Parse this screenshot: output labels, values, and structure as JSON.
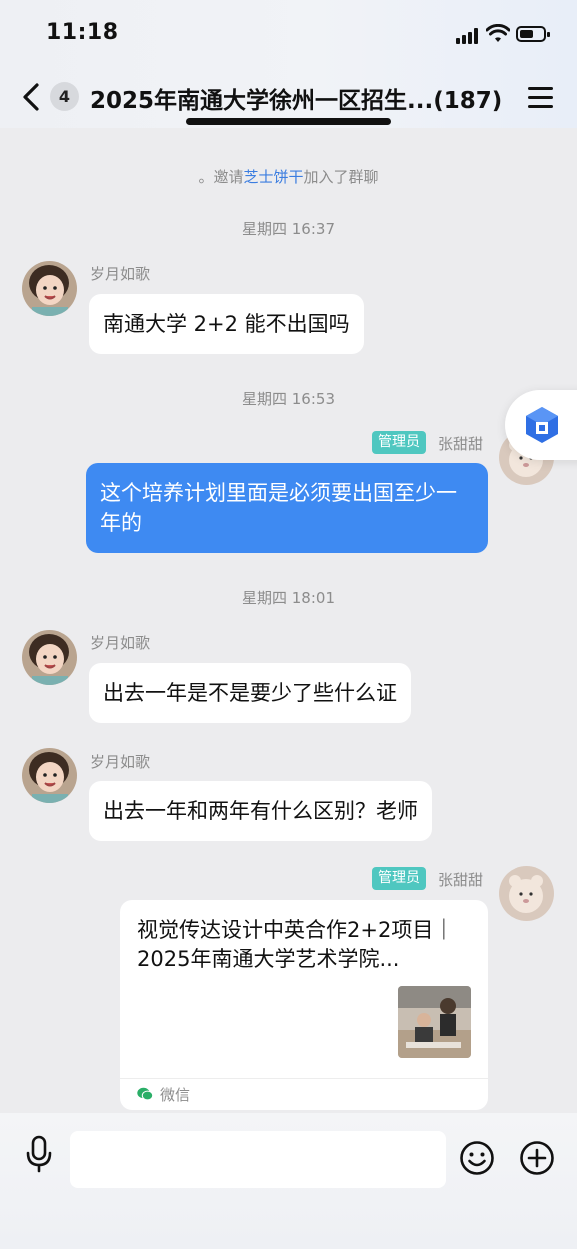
{
  "status_bar": {
    "time": "11:18"
  },
  "nav": {
    "unread_count": "4",
    "title": "2025年南通大学徐州一区招生...(187)"
  },
  "messages": {
    "system_prefix": "。邀请",
    "system_name": "芝士饼干",
    "system_suffix": "加入了群聊",
    "t1": "星期四 16:37",
    "m1_sender": "岁月如歌",
    "m1_text": "南通大学 2+2 能不出国吗",
    "t2": "星期四 16:53",
    "m2_role": "管理员",
    "m2_sender": "张甜甜",
    "m2_text": "这个培养计划里面是必须要出国至少一年的",
    "t3": "星期四 18:01",
    "m3_sender": "岁月如歌",
    "m3_text": "出去一年是不是要少了些什么证",
    "m4_sender": "岁月如歌",
    "m4_text": "出去一年和两年有什么区别？老师",
    "m5_role": "管理员",
    "m5_sender": "张甜甜",
    "card_title": "视觉传达设计中英合作2+2项目｜2025年南通大学艺术学院...",
    "card_source": "微信"
  },
  "colors": {
    "accent_blue": "#3e8af2",
    "link_blue": "#3b7de0",
    "role_badge": "#4fc7c0",
    "wechat_green": "#2aae67"
  },
  "icons": [
    "back-chevron-icon",
    "menu-icon",
    "mic-icon",
    "emoji-icon",
    "plus-icon",
    "wechat-icon",
    "assistant-cube-icon"
  ]
}
